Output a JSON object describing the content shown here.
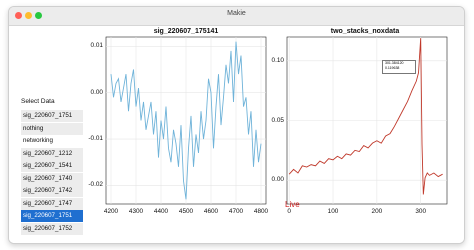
{
  "window": {
    "title": "Makie"
  },
  "sidebar": {
    "title": "Select Data",
    "items": [
      "sig_220607_1751",
      "nothing",
      "networking",
      "sig_220607_1212",
      "sig_220607_1541",
      "sig_220607_1740",
      "sig_220607_1742",
      "sig_220607_1747",
      "sig_220607_1751",
      "sig_220607_1752"
    ],
    "selected_index": 8
  },
  "live_label": "Live",
  "chart_data": [
    {
      "type": "line",
      "title": "sig_220607_175141",
      "x_ticks": [
        "4200",
        "4300",
        "4400",
        "4500",
        "4600",
        "4700",
        "4800"
      ],
      "y_ticks": [
        "0.01",
        "0.00",
        "-0.01",
        "-0.02"
      ],
      "xlim": [
        4180,
        4820
      ],
      "ylim": [
        -0.024,
        0.012
      ],
      "color": "#6fb3d9",
      "series": [
        {
          "x": [
            4200,
            4210,
            4220,
            4230,
            4240,
            4250,
            4260,
            4270,
            4280,
            4290,
            4300,
            4310,
            4320,
            4330,
            4340,
            4350,
            4360,
            4370,
            4380,
            4390,
            4400,
            4410,
            4420,
            4430,
            4440,
            4450,
            4460,
            4470,
            4480,
            4490,
            4500,
            4510,
            4520,
            4530,
            4540,
            4550,
            4560,
            4570,
            4580,
            4590,
            4600,
            4610,
            4620,
            4630,
            4640,
            4650,
            4660,
            4670,
            4680,
            4690,
            4700,
            4710,
            4720,
            4730,
            4740,
            4750,
            4760,
            4770,
            4780,
            4790,
            4800
          ],
          "y": [
            0.004,
            -0.001,
            0.002,
            0.003,
            -0.002,
            0.001,
            0.004,
            -0.004,
            0.002,
            0.005,
            -0.003,
            0.001,
            -0.006,
            -0.002,
            -0.008,
            -0.005,
            -0.002,
            -0.009,
            -0.004,
            -0.014,
            -0.006,
            -0.01,
            -0.003,
            -0.012,
            -0.015,
            -0.008,
            -0.011,
            -0.016,
            -0.007,
            -0.019,
            -0.023,
            -0.012,
            -0.005,
            -0.016,
            -0.009,
            -0.013,
            -0.004,
            -0.01,
            -0.006,
            0.003,
            0.0,
            -0.012,
            -0.003,
            0.004,
            -0.007,
            -0.001,
            0.006,
            0.002,
            0.009,
            -0.002,
            0.011,
            0.004,
            0.008,
            -0.003,
            -0.001,
            -0.009,
            -0.004,
            -0.016,
            -0.008,
            -0.015,
            -0.011
          ]
        }
      ]
    },
    {
      "type": "line",
      "title": "two_stacks_noxdata",
      "x_ticks": [
        "0",
        "100",
        "200",
        "300"
      ],
      "y_ticks": [
        "0.10",
        "0.05",
        "0.00"
      ],
      "xlim": [
        -5,
        360
      ],
      "ylim": [
        -0.02,
        0.12
      ],
      "color": "#c0392b",
      "legend": [
        "301.384120",
        "0.119638"
      ],
      "series": [
        {
          "x": [
            0,
            10,
            20,
            30,
            40,
            50,
            60,
            70,
            80,
            90,
            100,
            110,
            120,
            130,
            140,
            150,
            160,
            170,
            180,
            190,
            200,
            210,
            220,
            230,
            240,
            250,
            260,
            270,
            280,
            290,
            295,
            300,
            303,
            306,
            310,
            315,
            320,
            330,
            340,
            350
          ],
          "y": [
            0.005,
            0.009,
            0.006,
            0.012,
            0.011,
            0.013,
            0.012,
            0.016,
            0.014,
            0.018,
            0.017,
            0.02,
            0.018,
            0.022,
            0.021,
            0.025,
            0.024,
            0.029,
            0.027,
            0.031,
            0.033,
            0.031,
            0.037,
            0.039,
            0.045,
            0.052,
            0.059,
            0.066,
            0.075,
            0.083,
            0.09,
            0.119,
            0.03,
            -0.012,
            0.002,
            0.006,
            0.004,
            0.006,
            0.003,
            0.005
          ]
        }
      ]
    }
  ]
}
